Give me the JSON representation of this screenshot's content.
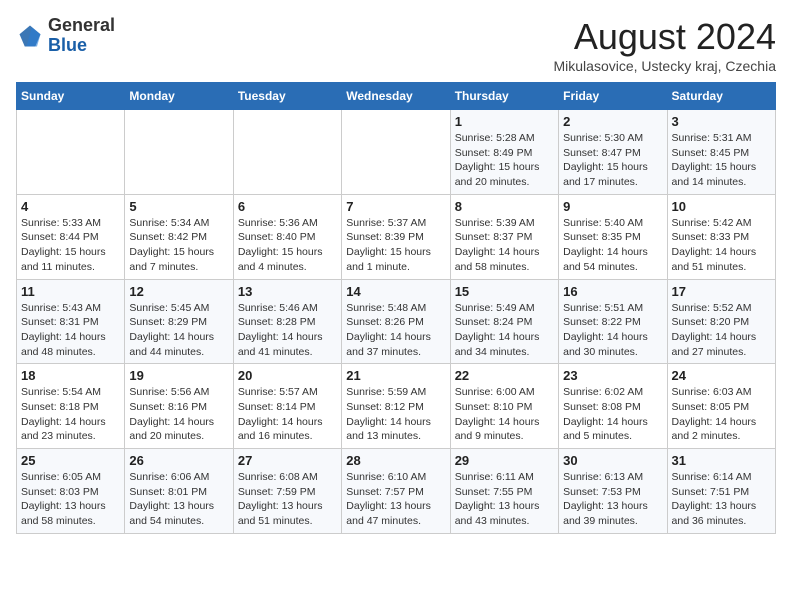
{
  "header": {
    "logo_general": "General",
    "logo_blue": "Blue",
    "month_title": "August 2024",
    "location": "Mikulasovice, Ustecky kraj, Czechia"
  },
  "weekdays": [
    "Sunday",
    "Monday",
    "Tuesday",
    "Wednesday",
    "Thursday",
    "Friday",
    "Saturday"
  ],
  "weeks": [
    [
      {
        "day": "",
        "info": ""
      },
      {
        "day": "",
        "info": ""
      },
      {
        "day": "",
        "info": ""
      },
      {
        "day": "",
        "info": ""
      },
      {
        "day": "1",
        "info": "Sunrise: 5:28 AM\nSunset: 8:49 PM\nDaylight: 15 hours\nand 20 minutes."
      },
      {
        "day": "2",
        "info": "Sunrise: 5:30 AM\nSunset: 8:47 PM\nDaylight: 15 hours\nand 17 minutes."
      },
      {
        "day": "3",
        "info": "Sunrise: 5:31 AM\nSunset: 8:45 PM\nDaylight: 15 hours\nand 14 minutes."
      }
    ],
    [
      {
        "day": "4",
        "info": "Sunrise: 5:33 AM\nSunset: 8:44 PM\nDaylight: 15 hours\nand 11 minutes."
      },
      {
        "day": "5",
        "info": "Sunrise: 5:34 AM\nSunset: 8:42 PM\nDaylight: 15 hours\nand 7 minutes."
      },
      {
        "day": "6",
        "info": "Sunrise: 5:36 AM\nSunset: 8:40 PM\nDaylight: 15 hours\nand 4 minutes."
      },
      {
        "day": "7",
        "info": "Sunrise: 5:37 AM\nSunset: 8:39 PM\nDaylight: 15 hours\nand 1 minute."
      },
      {
        "day": "8",
        "info": "Sunrise: 5:39 AM\nSunset: 8:37 PM\nDaylight: 14 hours\nand 58 minutes."
      },
      {
        "day": "9",
        "info": "Sunrise: 5:40 AM\nSunset: 8:35 PM\nDaylight: 14 hours\nand 54 minutes."
      },
      {
        "day": "10",
        "info": "Sunrise: 5:42 AM\nSunset: 8:33 PM\nDaylight: 14 hours\nand 51 minutes."
      }
    ],
    [
      {
        "day": "11",
        "info": "Sunrise: 5:43 AM\nSunset: 8:31 PM\nDaylight: 14 hours\nand 48 minutes."
      },
      {
        "day": "12",
        "info": "Sunrise: 5:45 AM\nSunset: 8:29 PM\nDaylight: 14 hours\nand 44 minutes."
      },
      {
        "day": "13",
        "info": "Sunrise: 5:46 AM\nSunset: 8:28 PM\nDaylight: 14 hours\nand 41 minutes."
      },
      {
        "day": "14",
        "info": "Sunrise: 5:48 AM\nSunset: 8:26 PM\nDaylight: 14 hours\nand 37 minutes."
      },
      {
        "day": "15",
        "info": "Sunrise: 5:49 AM\nSunset: 8:24 PM\nDaylight: 14 hours\nand 34 minutes."
      },
      {
        "day": "16",
        "info": "Sunrise: 5:51 AM\nSunset: 8:22 PM\nDaylight: 14 hours\nand 30 minutes."
      },
      {
        "day": "17",
        "info": "Sunrise: 5:52 AM\nSunset: 8:20 PM\nDaylight: 14 hours\nand 27 minutes."
      }
    ],
    [
      {
        "day": "18",
        "info": "Sunrise: 5:54 AM\nSunset: 8:18 PM\nDaylight: 14 hours\nand 23 minutes."
      },
      {
        "day": "19",
        "info": "Sunrise: 5:56 AM\nSunset: 8:16 PM\nDaylight: 14 hours\nand 20 minutes."
      },
      {
        "day": "20",
        "info": "Sunrise: 5:57 AM\nSunset: 8:14 PM\nDaylight: 14 hours\nand 16 minutes."
      },
      {
        "day": "21",
        "info": "Sunrise: 5:59 AM\nSunset: 8:12 PM\nDaylight: 14 hours\nand 13 minutes."
      },
      {
        "day": "22",
        "info": "Sunrise: 6:00 AM\nSunset: 8:10 PM\nDaylight: 14 hours\nand 9 minutes."
      },
      {
        "day": "23",
        "info": "Sunrise: 6:02 AM\nSunset: 8:08 PM\nDaylight: 14 hours\nand 5 minutes."
      },
      {
        "day": "24",
        "info": "Sunrise: 6:03 AM\nSunset: 8:05 PM\nDaylight: 14 hours\nand 2 minutes."
      }
    ],
    [
      {
        "day": "25",
        "info": "Sunrise: 6:05 AM\nSunset: 8:03 PM\nDaylight: 13 hours\nand 58 minutes."
      },
      {
        "day": "26",
        "info": "Sunrise: 6:06 AM\nSunset: 8:01 PM\nDaylight: 13 hours\nand 54 minutes."
      },
      {
        "day": "27",
        "info": "Sunrise: 6:08 AM\nSunset: 7:59 PM\nDaylight: 13 hours\nand 51 minutes."
      },
      {
        "day": "28",
        "info": "Sunrise: 6:10 AM\nSunset: 7:57 PM\nDaylight: 13 hours\nand 47 minutes."
      },
      {
        "day": "29",
        "info": "Sunrise: 6:11 AM\nSunset: 7:55 PM\nDaylight: 13 hours\nand 43 minutes."
      },
      {
        "day": "30",
        "info": "Sunrise: 6:13 AM\nSunset: 7:53 PM\nDaylight: 13 hours\nand 39 minutes."
      },
      {
        "day": "31",
        "info": "Sunrise: 6:14 AM\nSunset: 7:51 PM\nDaylight: 13 hours\nand 36 minutes."
      }
    ]
  ]
}
